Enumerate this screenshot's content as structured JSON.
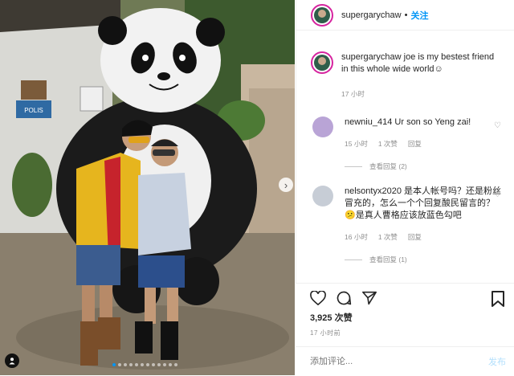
{
  "post": {
    "carousel_dot_count": 12,
    "carousel_active_index": 0,
    "photo_sign_text": "POLIS"
  },
  "header": {
    "username": "supergarychaw",
    "separator": "•",
    "follow_label": "关注"
  },
  "caption": {
    "username": "supergarychaw",
    "text": "joe is my bestest friend in this whole wide world☺",
    "time": "17 小时"
  },
  "comments": [
    {
      "username": "newniu_414",
      "text": "Ur son so Yeng zai!",
      "time": "15 小时",
      "likes": "1 次赞",
      "reply": "回复",
      "view_replies": "查看回复 (2)",
      "avatar_color": "#b9a4d6"
    },
    {
      "username": "nelsontyx2020",
      "text": "是本人帐号吗？还是粉丝冒充的，怎么一个个回复酸民留言的？😕是真人曹格应该放蓝色勾吧",
      "time": "16 小时",
      "likes": "1 次赞",
      "reply": "回复",
      "view_replies": "查看回复 (1)",
      "avatar_color": "#c7cdd6"
    }
  ],
  "actions": {
    "likes": "3,925 次赞",
    "timestamp": "17 小时前",
    "add_comment_placeholder": "添加评论...",
    "post_label": "发布"
  },
  "colors": {
    "accent": "#0095f6",
    "muted": "#8e8e8e",
    "post_disabled": "#b2dffc"
  }
}
